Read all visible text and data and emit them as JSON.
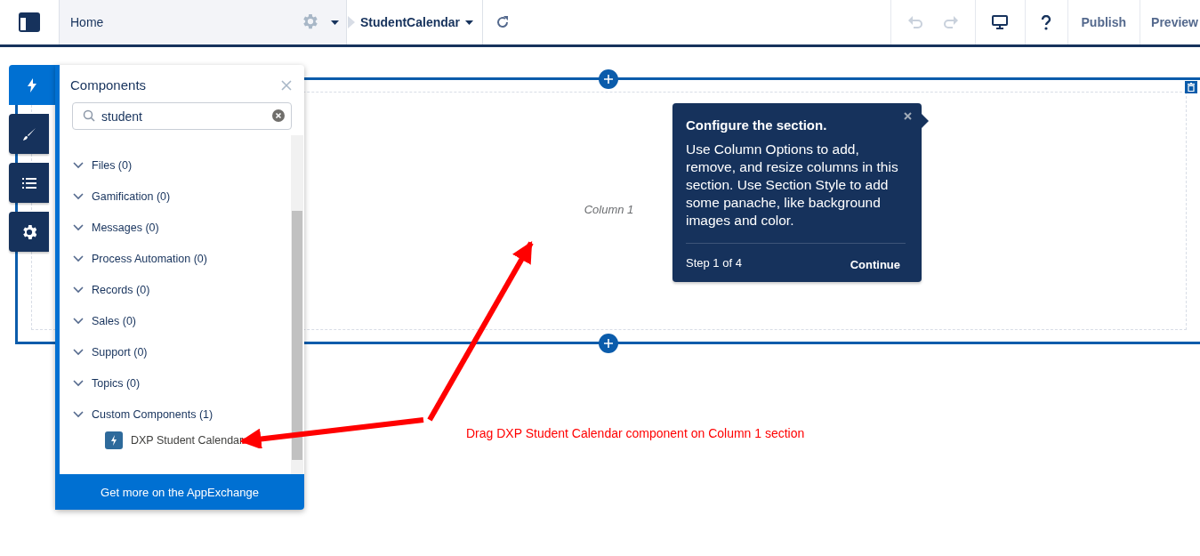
{
  "topbar": {
    "home_label": "Home",
    "page_name": "StudentCalendar",
    "undo_disabled": true,
    "redo_disabled": true,
    "buttons": [
      "Publish",
      "Preview"
    ]
  },
  "side_tabs": [
    {
      "selected": true
    },
    {
      "selected": false
    },
    {
      "selected": false
    },
    {
      "selected": false
    }
  ],
  "components_panel": {
    "title": "Components",
    "search": {
      "value": "student"
    },
    "categories": [
      {
        "label": "Files (0)",
        "expanded": true
      },
      {
        "label": "Gamification (0)",
        "expanded": true
      },
      {
        "label": "Messages (0)",
        "expanded": true
      },
      {
        "label": "Process Automation (0)",
        "expanded": true
      },
      {
        "label": "Records (0)",
        "expanded": true
      },
      {
        "label": "Sales (0)",
        "expanded": true
      },
      {
        "label": "Support (0)",
        "expanded": true
      },
      {
        "label": "Topics (0)",
        "expanded": true
      },
      {
        "label": "Custom Components (1)",
        "expanded": true,
        "children": [
          {
            "label": "DXP Student Calendar"
          }
        ]
      }
    ],
    "footer": "Get more on the AppExchange"
  },
  "section": {
    "column_label": "Column 1"
  },
  "popover": {
    "title": "Configure the section.",
    "body": "Use Column Options to add, remove, and resize columns in this section. Use Section Style to add some panache, like background images and color.",
    "step": "Step 1 of 4",
    "button": "Continue"
  },
  "annotation": {
    "text": "Drag DXP Student Calendar component on Column 1 section"
  }
}
